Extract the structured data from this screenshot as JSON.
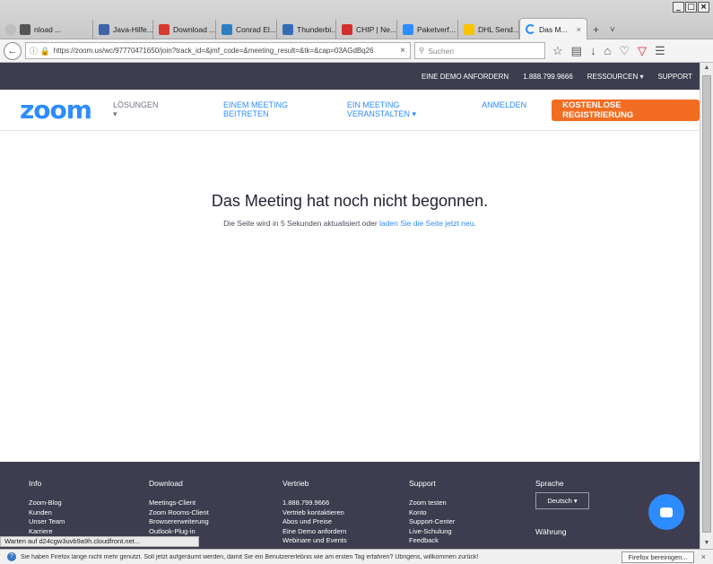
{
  "browser": {
    "window_controls": [
      "_",
      "□",
      "×"
    ],
    "tabs": [
      {
        "label": "nload ...",
        "color": "#6b6b6b"
      },
      {
        "label": "Java-Hilfe...",
        "color": "#3f62a8"
      },
      {
        "label": "Download ...",
        "color": "#d83a2f"
      },
      {
        "label": "Conrad El...",
        "color": "#2b7fc1"
      },
      {
        "label": "Thunderbi...",
        "color": "#356cb5"
      },
      {
        "label": "CHIP | Ne...",
        "color": "#d32f2f"
      },
      {
        "label": "Paketverf...",
        "color": "#2d8cff"
      },
      {
        "label": "DHL Send...",
        "color": "#f8c300"
      },
      {
        "label": "Das M...",
        "color": "#2d8cff"
      }
    ],
    "active_tab_close": "×",
    "new_tab": "+",
    "tab_list_arrow": "˅",
    "url": "https://zoom.us/wc/97770471650/join?track_id=&jmf_code=&meeting_result=&tk=&cap=03AGdBq26",
    "url_clear": "×",
    "search_placeholder": "Suchen",
    "icons": [
      "star-icon",
      "bookmarks-icon",
      "download-icon",
      "home-icon",
      "pocket-icon",
      "extension-icon",
      "menu-icon"
    ]
  },
  "zoom": {
    "util_links": [
      "EINE DEMO ANFORDERN",
      "1.888.799.9666",
      "RESSOURCEN ▾",
      "SUPPORT"
    ],
    "logo": "zoom",
    "nav_solutions": "LÖSUNGEN ▾",
    "nav_links": [
      "EINEM MEETING BEITRETEN",
      "EIN MEETING VERANSTALTEN ▾",
      "ANMELDEN"
    ],
    "cta": "KOSTENLOSE REGISTRIERUNG",
    "message_title": "Das Meeting hat noch nicht begonnen.",
    "message_prefix": "Die Seite wird in 5 Sekunden aktualisiert oder ",
    "message_link": "laden Sie die Seite jetzt neu",
    "message_suffix": ".",
    "footer": {
      "info_title": "Info",
      "info_items": [
        "Zoom-Blog",
        "Kunden",
        "Unser Team",
        "Karriere"
      ],
      "download_title": "Download",
      "download_items": [
        "Meetings-Client",
        "Zoom Rooms-Client",
        "Browsererweiterung",
        "Outlook-Plug-in"
      ],
      "sales_title": "Vertrieb",
      "sales_items": [
        "1.888.799.9666",
        "Vertrieb kontaktieren",
        "Abos und Preise",
        "Eine Demo anfordern",
        "Webinare und Events"
      ],
      "support_title": "Support",
      "support_items": [
        "Zoom testen",
        "Konto",
        "Support-Center",
        "Live-Schulung",
        "Feedback"
      ],
      "language_title": "Sprache",
      "language_value": "Deutsch ▾",
      "currency_title": "Währung"
    }
  },
  "status": "Warten auf d24cgw3uvb9a9h.cloudfront.net...",
  "notification": {
    "text": "Sie haben Firefox lange nicht mehr genutzt. Soll jetzt aufgeräumt werden, damit Sie ein Benutzererlebnis wie am ersten Tag erfahren? Übrigens, willkommen zurück!",
    "button": "Firefox bereinigen...",
    "close": "×"
  }
}
